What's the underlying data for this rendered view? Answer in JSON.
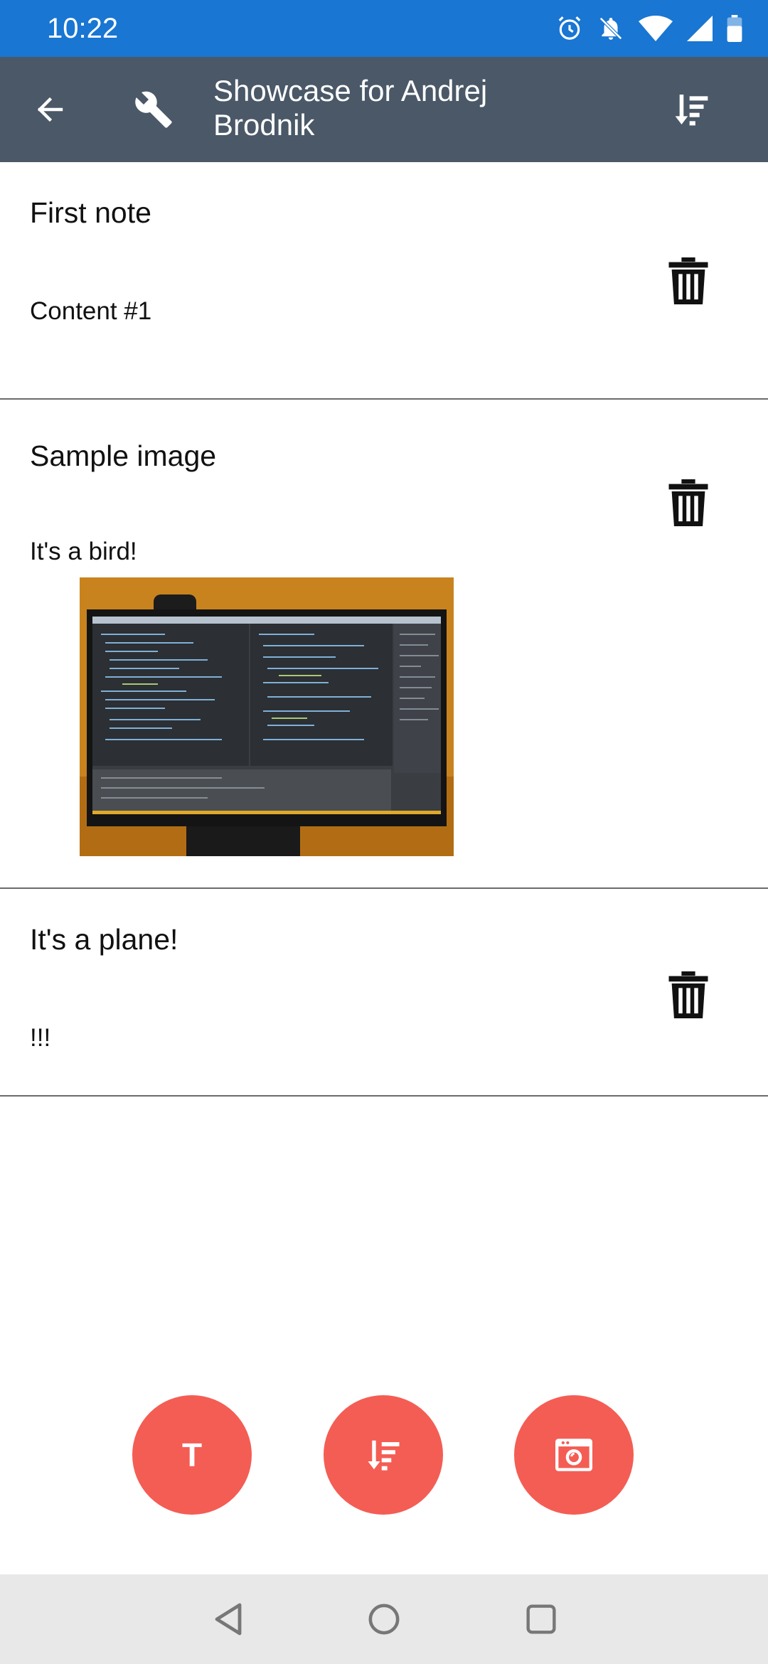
{
  "status_bar": {
    "time": "10:22",
    "background": "#1976d2",
    "icons": [
      "alarm-icon",
      "notifications-off-icon",
      "wifi-icon",
      "signal-icon",
      "battery-icon"
    ]
  },
  "app_bar": {
    "title": "Showcase for Andrej Brodnik",
    "background": "#4a5867",
    "icons": [
      "back-arrow-icon",
      "wrench-icon",
      "sort-icon"
    ]
  },
  "notes": [
    {
      "title": "First note",
      "content": "Content #1",
      "has_image": false
    },
    {
      "title": "Sample image",
      "content": "It's a bird!",
      "has_image": true
    },
    {
      "title": "It's a plane!",
      "content": "!!!",
      "has_image": false
    }
  ],
  "fabs": {
    "color": "#f45d54",
    "text_glyph": "T",
    "icons": [
      "text-note-icon",
      "sort-icon",
      "camera-icon"
    ]
  },
  "nav_bar": {
    "icons": [
      "nav-back-icon",
      "nav-home-icon",
      "nav-recents-icon"
    ]
  }
}
